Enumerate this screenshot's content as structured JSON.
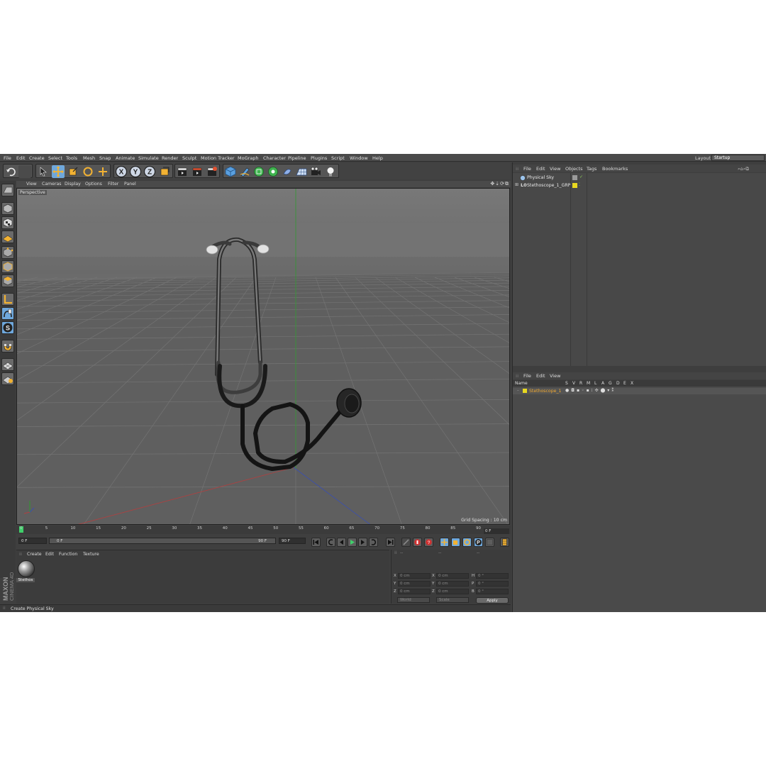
{
  "menubar": {
    "items": [
      "File",
      "Edit",
      "Create",
      "Select",
      "Tools",
      "Mesh",
      "Snap",
      "Animate",
      "Simulate",
      "Render",
      "Sculpt",
      "Motion Tracker",
      "MoGraph",
      "Character",
      "Pipeline",
      "Plugins",
      "Script",
      "Window",
      "Help"
    ],
    "layout_label": "Layout:",
    "layout_value": "Startup"
  },
  "toolbar": {
    "axis_x": "X",
    "axis_y": "Y",
    "axis_z": "Z"
  },
  "viewport": {
    "menu": [
      "View",
      "Cameras",
      "Display",
      "Options",
      "Filter",
      "Panel"
    ],
    "camera_label": "Perspective",
    "grid_spacing": "Grid Spacing : 10 cm"
  },
  "timeline": {
    "ticks": [
      "0",
      "5",
      "10",
      "15",
      "20",
      "25",
      "30",
      "35",
      "40",
      "45",
      "50",
      "55",
      "60",
      "65",
      "70",
      "75",
      "80",
      "85",
      "90"
    ],
    "current_frame": "0 F",
    "start_field": "0 F",
    "slider_start": "0 F",
    "slider_end": "90 F",
    "end_field": "90 F"
  },
  "material_manager": {
    "menu": [
      "Create",
      "Edit",
      "Function",
      "Texture"
    ],
    "material_name": "Stethos"
  },
  "brand": {
    "line1": "MAXON",
    "line2": "CINEMA 4D"
  },
  "coordinates": {
    "header": [
      "--",
      "--",
      "--"
    ],
    "rows": [
      {
        "a": "X",
        "av": "0 cm",
        "b": "X",
        "bv": "0 cm",
        "c": "H",
        "cv": "0 °"
      },
      {
        "a": "Y",
        "av": "0 cm",
        "b": "Y",
        "bv": "0 cm",
        "c": "P",
        "cv": "0 °"
      },
      {
        "a": "Z",
        "av": "0 cm",
        "b": "Z",
        "bv": "0 cm",
        "c": "B",
        "cv": "0 °"
      }
    ],
    "mode": "World",
    "scale": "Scale",
    "apply_label": "Apply"
  },
  "status": {
    "text": "Create Physical Sky"
  },
  "object_manager": {
    "menu": [
      "File",
      "Edit",
      "View",
      "Objects",
      "Tags",
      "Bookmarks"
    ],
    "objects": [
      {
        "name": "Physical Sky"
      },
      {
        "name": "Stethoscope_1_GRP"
      }
    ]
  },
  "layer_manager": {
    "menu": [
      "File",
      "Edit",
      "View"
    ],
    "columns": [
      "Name",
      "S",
      "V",
      "R",
      "M",
      "L",
      "A",
      "G",
      "D",
      "E",
      "X"
    ],
    "layer_name": "Stethoscope_1"
  },
  "colors": {
    "app_bg": "#3f3f3f",
    "viewport_bg": "#6b6b6b",
    "accent_blue": "#6fa8dc",
    "layer_color": "#f0a830",
    "object_yellow": "#e8d820"
  }
}
